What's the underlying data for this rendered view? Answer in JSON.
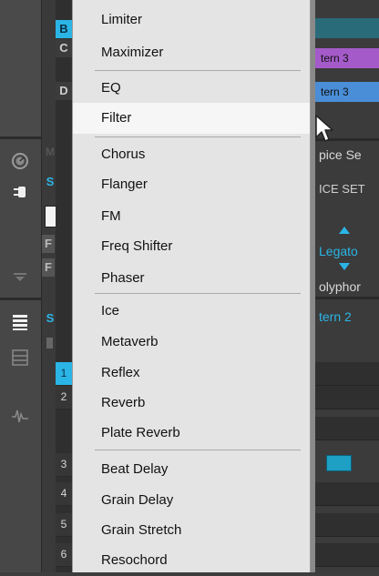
{
  "left_panel": {
    "group_letters": [
      "B",
      "C",
      "D"
    ],
    "sound_letters": [
      "M",
      "S",
      "F",
      "F",
      "S"
    ],
    "pad_numbers": [
      "1",
      "2",
      "3",
      "4",
      "5",
      "6"
    ]
  },
  "right_panel": {
    "patterns": [
      "tern 3",
      "tern 3"
    ],
    "voice_settings_label": "pice Se",
    "voice_settings_header": "ICE SET",
    "mode_value": "Legato",
    "polyphony_label": "olyphor",
    "pattern_label": "tern 2"
  },
  "menu": {
    "items": [
      {
        "label": "Limiter"
      },
      {
        "label": "Maximizer"
      },
      {
        "label": "EQ"
      },
      {
        "label": "Filter",
        "highlighted": true
      },
      {
        "label": "Chorus"
      },
      {
        "label": "Flanger"
      },
      {
        "label": "FM"
      },
      {
        "label": "Freq Shifter"
      },
      {
        "label": "Phaser"
      },
      {
        "label": "Ice"
      },
      {
        "label": "Metaverb"
      },
      {
        "label": "Reflex"
      },
      {
        "label": "Reverb"
      },
      {
        "label": "Plate Reverb"
      },
      {
        "label": "Beat Delay"
      },
      {
        "label": "Grain Delay"
      },
      {
        "label": "Grain Stretch"
      },
      {
        "label": "Resochord"
      }
    ]
  },
  "colors": {
    "menu_bg": "#e4e4e4",
    "highlight_bg": "#f6f6f6",
    "accent_blue": "#2bb5e6",
    "pattern_purple": "#a45bc9",
    "pattern_blue": "#4a8ed8",
    "teal_cell": "#1e9fc4"
  }
}
